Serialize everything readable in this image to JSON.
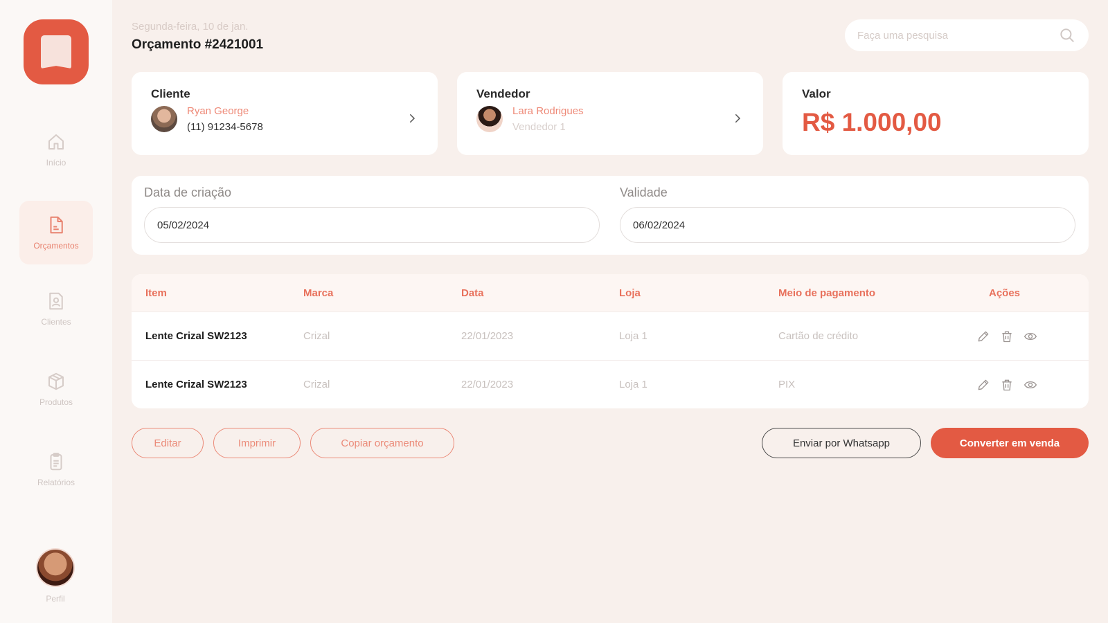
{
  "sidebar": {
    "items": [
      {
        "label": "Início",
        "icon": "home-icon"
      },
      {
        "label": "Orçamentos",
        "icon": "document-icon"
      },
      {
        "label": "Clientes",
        "icon": "client-icon"
      },
      {
        "label": "Produtos",
        "icon": "box-icon"
      },
      {
        "label": "Relatórios",
        "icon": "report-icon"
      }
    ],
    "active_index": 1,
    "profile_label": "Perfil"
  },
  "header": {
    "date": "Segunda-feira, 10 de jan.",
    "title": "Orçamento #2421001"
  },
  "search": {
    "placeholder": "Faça uma pesquisa"
  },
  "cards": {
    "client": {
      "title": "Cliente",
      "name": "Ryan George",
      "phone": "(11) 91234-5678"
    },
    "seller": {
      "title": "Vendedor",
      "name": "Lara Rodrigues",
      "role": "Vendedor 1"
    },
    "value": {
      "title": "Valor",
      "amount": "R$ 1.000,00"
    }
  },
  "dates": {
    "created_label": "Data de criação",
    "created_value": "05/02/2024",
    "validity_label": "Validade",
    "validity_value": "06/02/2024"
  },
  "table": {
    "headers": [
      "Item",
      "Marca",
      "Data",
      "Loja",
      "Meio de pagamento",
      "Ações"
    ],
    "rows": [
      {
        "item": "Lente Crizal SW2123",
        "brand": "Crizal",
        "date": "22/01/2023",
        "store": "Loja 1",
        "payment": "Cartão de crédito"
      },
      {
        "item": "Lente Crizal SW2123",
        "brand": "Crizal",
        "date": "22/01/2023",
        "store": "Loja 1",
        "payment": "PIX"
      }
    ]
  },
  "buttons": {
    "edit": "Editar",
    "print": "Imprimir",
    "copy": "Copiar orçamento",
    "whatsapp": "Enviar por Whatsapp",
    "convert": "Converter em venda"
  },
  "colors": {
    "accent": "#e35a43",
    "accent_light": "#ee8a78",
    "background": "#f8f0ec"
  }
}
